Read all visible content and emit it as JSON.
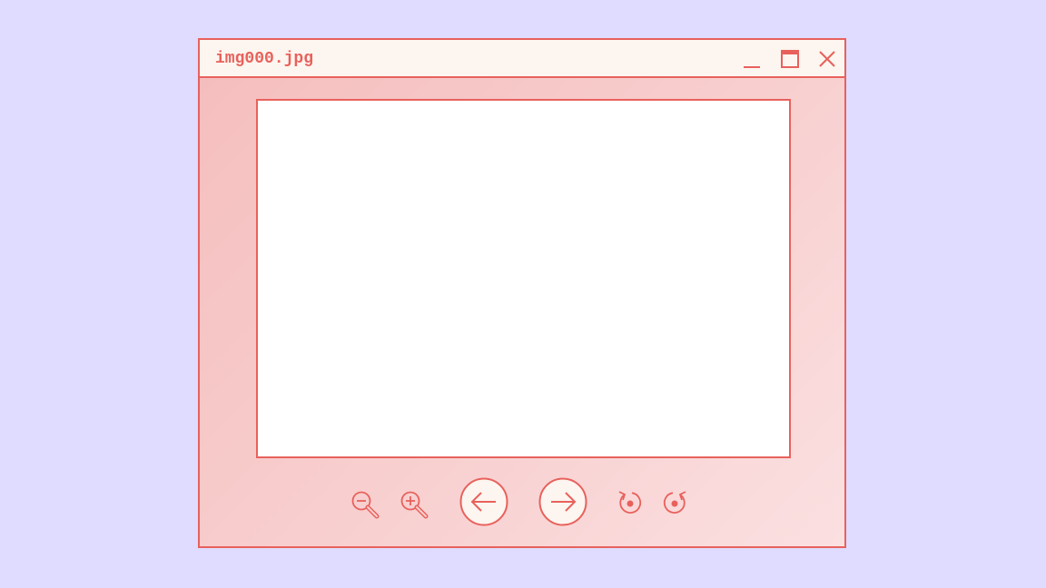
{
  "window": {
    "title": "img000.jpg"
  },
  "controls": {
    "minimize_icon": "minimize-icon",
    "maximize_icon": "maximize-icon",
    "close_icon": "close-icon"
  },
  "toolbar": {
    "icons": [
      "zoom-out-icon",
      "zoom-in-icon",
      "arrow-left-icon",
      "arrow-right-icon",
      "rotate-left-icon",
      "rotate-right-icon"
    ]
  },
  "colors": {
    "background": "#dfdcff",
    "accent": "#e8615c",
    "titlebar": "#fdf5ef",
    "window_fill": "#f8cfcf",
    "viewport": "#ffffff"
  }
}
